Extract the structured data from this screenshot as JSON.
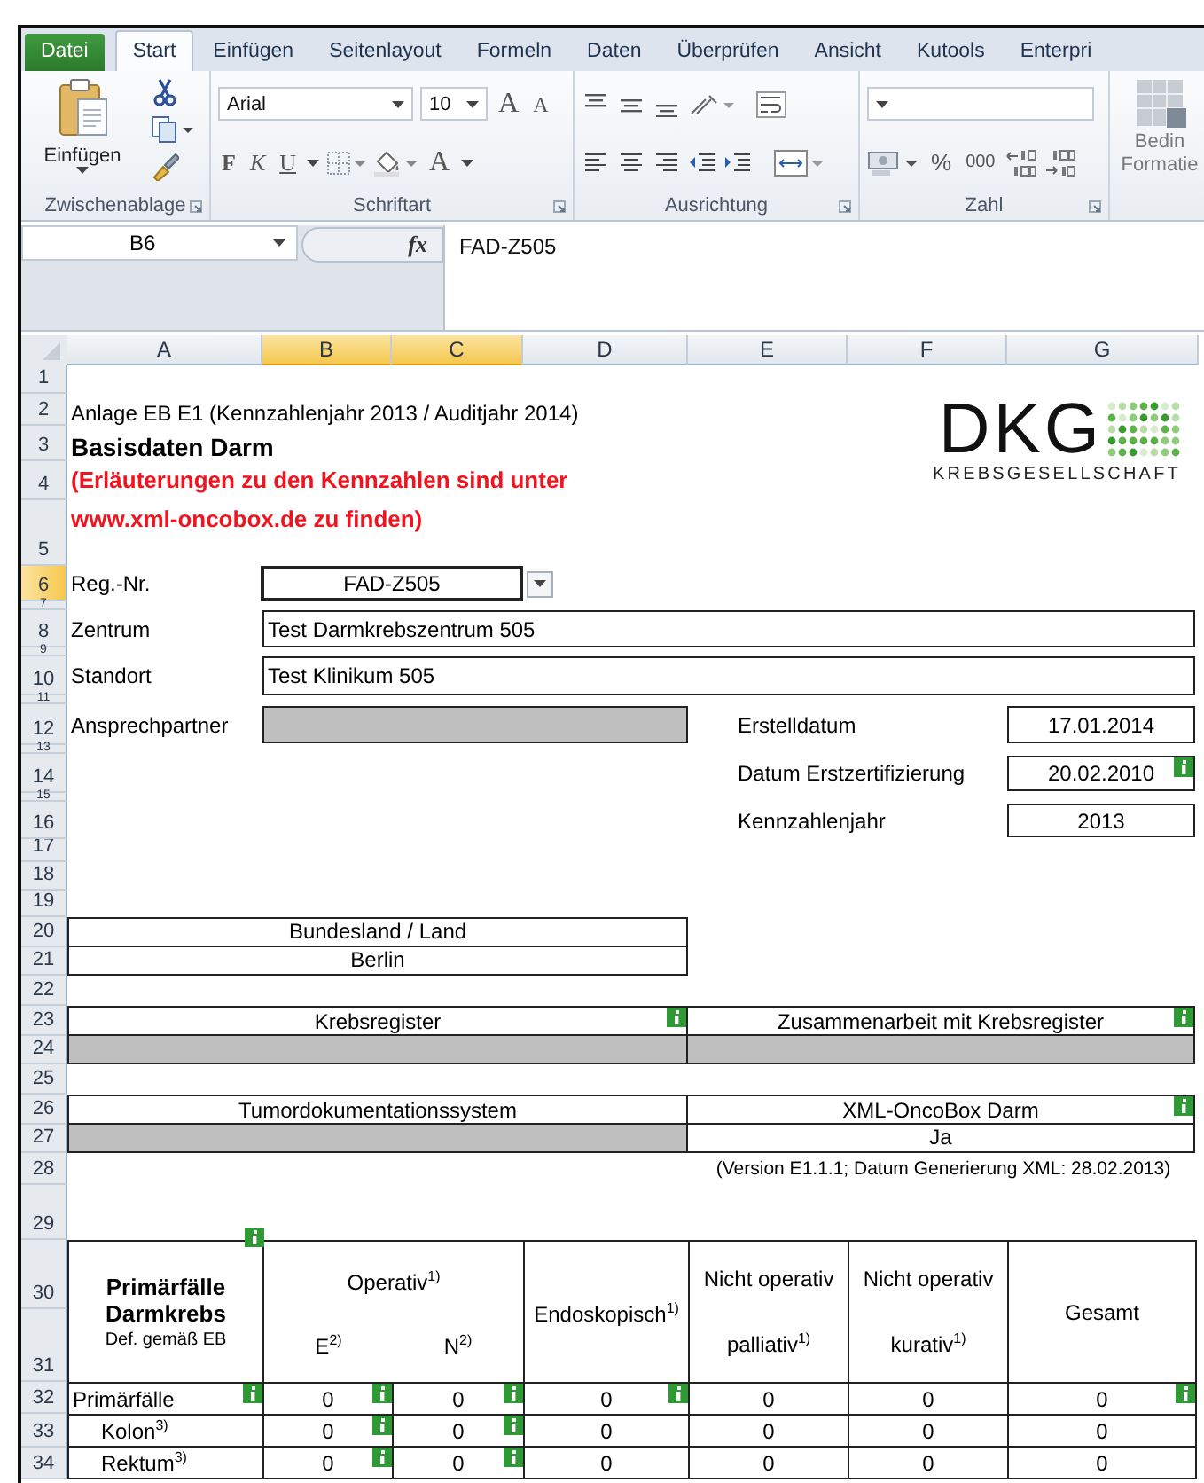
{
  "tabs": [
    {
      "label": "Datei",
      "kind": "file",
      "selected": false
    },
    {
      "label": "Start",
      "kind": "tab",
      "selected": true
    },
    {
      "label": "Einfügen",
      "kind": "tab",
      "selected": false
    },
    {
      "label": "Seitenlayout",
      "kind": "tab",
      "selected": false
    },
    {
      "label": "Formeln",
      "kind": "tab",
      "selected": false
    },
    {
      "label": "Daten",
      "kind": "tab",
      "selected": false
    },
    {
      "label": "Überprüfen",
      "kind": "tab",
      "selected": false
    },
    {
      "label": "Ansicht",
      "kind": "tab",
      "selected": false
    },
    {
      "label": "Kutools",
      "kind": "tab",
      "selected": false
    },
    {
      "label": "Enterpri",
      "kind": "tab",
      "selected": false
    }
  ],
  "ribbon": {
    "clipboard": {
      "label": "Zwischenablage",
      "paste": "Einfügen"
    },
    "font": {
      "label": "Schriftart",
      "name": "Arial",
      "size": "10",
      "grow": "A",
      "shrink": "A",
      "bold": "F",
      "italic": "K",
      "underline": "U",
      "font_color_label": "A"
    },
    "alignment": {
      "label": "Ausrichtung"
    },
    "number": {
      "label": "Zahl",
      "percent": "%",
      "thousands": "000"
    },
    "conditional": {
      "lines": [
        "Bedin",
        "Formatie"
      ]
    }
  },
  "formula_bar": {
    "name_box": "B6",
    "fx": "fx",
    "value": "FAD-Z505"
  },
  "columns": [
    {
      "label": "A",
      "selected": false
    },
    {
      "label": "B",
      "selected": true
    },
    {
      "label": "C",
      "selected": true
    },
    {
      "label": "D",
      "selected": false
    },
    {
      "label": "E",
      "selected": false
    },
    {
      "label": "F",
      "selected": false
    },
    {
      "label": "G",
      "selected": false
    }
  ],
  "rows": [
    {
      "label": "1",
      "selected": false
    },
    {
      "label": "2",
      "selected": false
    },
    {
      "label": "3",
      "selected": false
    },
    {
      "label": "4",
      "selected": false
    },
    {
      "label": "5",
      "selected": false
    },
    {
      "label": "6",
      "selected": true
    },
    {
      "label": "7",
      "selected": false
    },
    {
      "label": "8",
      "selected": false
    },
    {
      "label": "9",
      "selected": false
    },
    {
      "label": "10",
      "selected": false
    },
    {
      "label": "11",
      "selected": false
    },
    {
      "label": "12",
      "selected": false
    },
    {
      "label": "13",
      "selected": false
    },
    {
      "label": "14",
      "selected": false
    },
    {
      "label": "15",
      "selected": false
    },
    {
      "label": "16",
      "selected": false
    },
    {
      "label": "17",
      "selected": false
    },
    {
      "label": "18",
      "selected": false
    },
    {
      "label": "19",
      "selected": false
    },
    {
      "label": "20",
      "selected": false
    },
    {
      "label": "21",
      "selected": false
    },
    {
      "label": "22",
      "selected": false
    },
    {
      "label": "23",
      "selected": false
    },
    {
      "label": "24",
      "selected": false
    },
    {
      "label": "25",
      "selected": false
    },
    {
      "label": "26",
      "selected": false
    },
    {
      "label": "27",
      "selected": false
    },
    {
      "label": "28",
      "selected": false
    },
    {
      "label": "29",
      "selected": false
    },
    {
      "label": "30",
      "selected": false
    },
    {
      "label": "31",
      "selected": false
    },
    {
      "label": "32",
      "selected": false
    },
    {
      "label": "33",
      "selected": false
    },
    {
      "label": "34",
      "selected": false
    }
  ],
  "sheet": {
    "title": "Anlage EB E1 (Kennzahlenjahr 2013 / Auditjahr 2014)",
    "heading": "Basisdaten Darm",
    "note": "(Erläuterungen zu den Kennzahlen sind unter www.xml-oncobox.de zu finden)",
    "logo": {
      "name": "DKG",
      "subtitle": "KREBSGESELLSCHAFT"
    },
    "fields": [
      {
        "label": "Reg.-Nr.",
        "value": "FAD-Z505",
        "kind": "dropdown",
        "selected": true
      },
      {
        "label": "Zentrum",
        "value": "Test Darmkrebszentrum 505",
        "kind": "text",
        "selected": false
      },
      {
        "label": "Standort",
        "value": "Test Klinikum 505",
        "kind": "text",
        "selected": false
      },
      {
        "label": "Ansprechpartner",
        "kind": "locked",
        "selected": false
      }
    ],
    "dates": [
      {
        "label": "Erstelldatum",
        "value": "17.01.2014",
        "info": false
      },
      {
        "label": "Datum Erstzertifizierung",
        "value": "20.02.2010",
        "info": true
      },
      {
        "label": "Kennzahlenjahr",
        "value": "2013",
        "info": false
      }
    ],
    "region": {
      "header": "Bundesland / Land",
      "value": "Berlin"
    },
    "registry": [
      {
        "header": "Krebsregister",
        "info": true,
        "kind": "locked"
      },
      {
        "header": "Zusammenarbeit mit Krebsregister",
        "info": true,
        "kind": "locked"
      }
    ],
    "documentation": [
      {
        "header": "Tumordokumentationssystem",
        "info": false,
        "kind": "locked"
      },
      {
        "header": "XML-OncoBox Darm",
        "info": true,
        "kind": "text",
        "value": "Ja"
      }
    ],
    "version": "(Version E1.1.1; Datum Generierung XML: 28.02.2013)",
    "table": {
      "corner": {
        "title": "Primärfälle Darmkrebs",
        "subtitle": "Def. gemäß EB",
        "info": true
      },
      "group_header": "Operativ$^{1)}$",
      "columns": [
        "E$^{2)}$",
        "N$^{2)}$",
        "Endoskopisch$^{1)}$",
        "Nicht operativ palliativ$^{1)}$",
        "Nicht operativ kurativ$^{1)}$",
        "Gesamt"
      ],
      "rows": [
        {
          "label": "Primärfälle",
          "info": true,
          "cells": [
            {
              "value": "0",
              "info": true
            },
            {
              "value": "0",
              "info": true
            },
            {
              "value": "0",
              "info": true
            },
            {
              "value": "0",
              "info": false
            },
            {
              "value": "0",
              "info": false
            },
            {
              "value": "0",
              "info": true
            }
          ],
          "children": [
            {
              "label": "Kolon$^{3)}$",
              "info": false,
              "cells": [
                {
                  "value": "0",
                  "info": true
                },
                {
                  "value": "0",
                  "info": true
                },
                {
                  "value": "0",
                  "info": false
                },
                {
                  "value": "0",
                  "info": false
                },
                {
                  "value": "0",
                  "info": false
                },
                {
                  "value": "0",
                  "info": false
                }
              ]
            },
            {
              "label": "Rektum$^{3)}$",
              "info": false,
              "cells": [
                {
                  "value": "0",
                  "info": true
                },
                {
                  "value": "0",
                  "info": true
                },
                {
                  "value": "0",
                  "info": false
                },
                {
                  "value": "0",
                  "info": false
                },
                {
                  "value": "0",
                  "info": false
                },
                {
                  "value": "0",
                  "info": false
                }
              ]
            }
          ]
        }
      ]
    }
  }
}
